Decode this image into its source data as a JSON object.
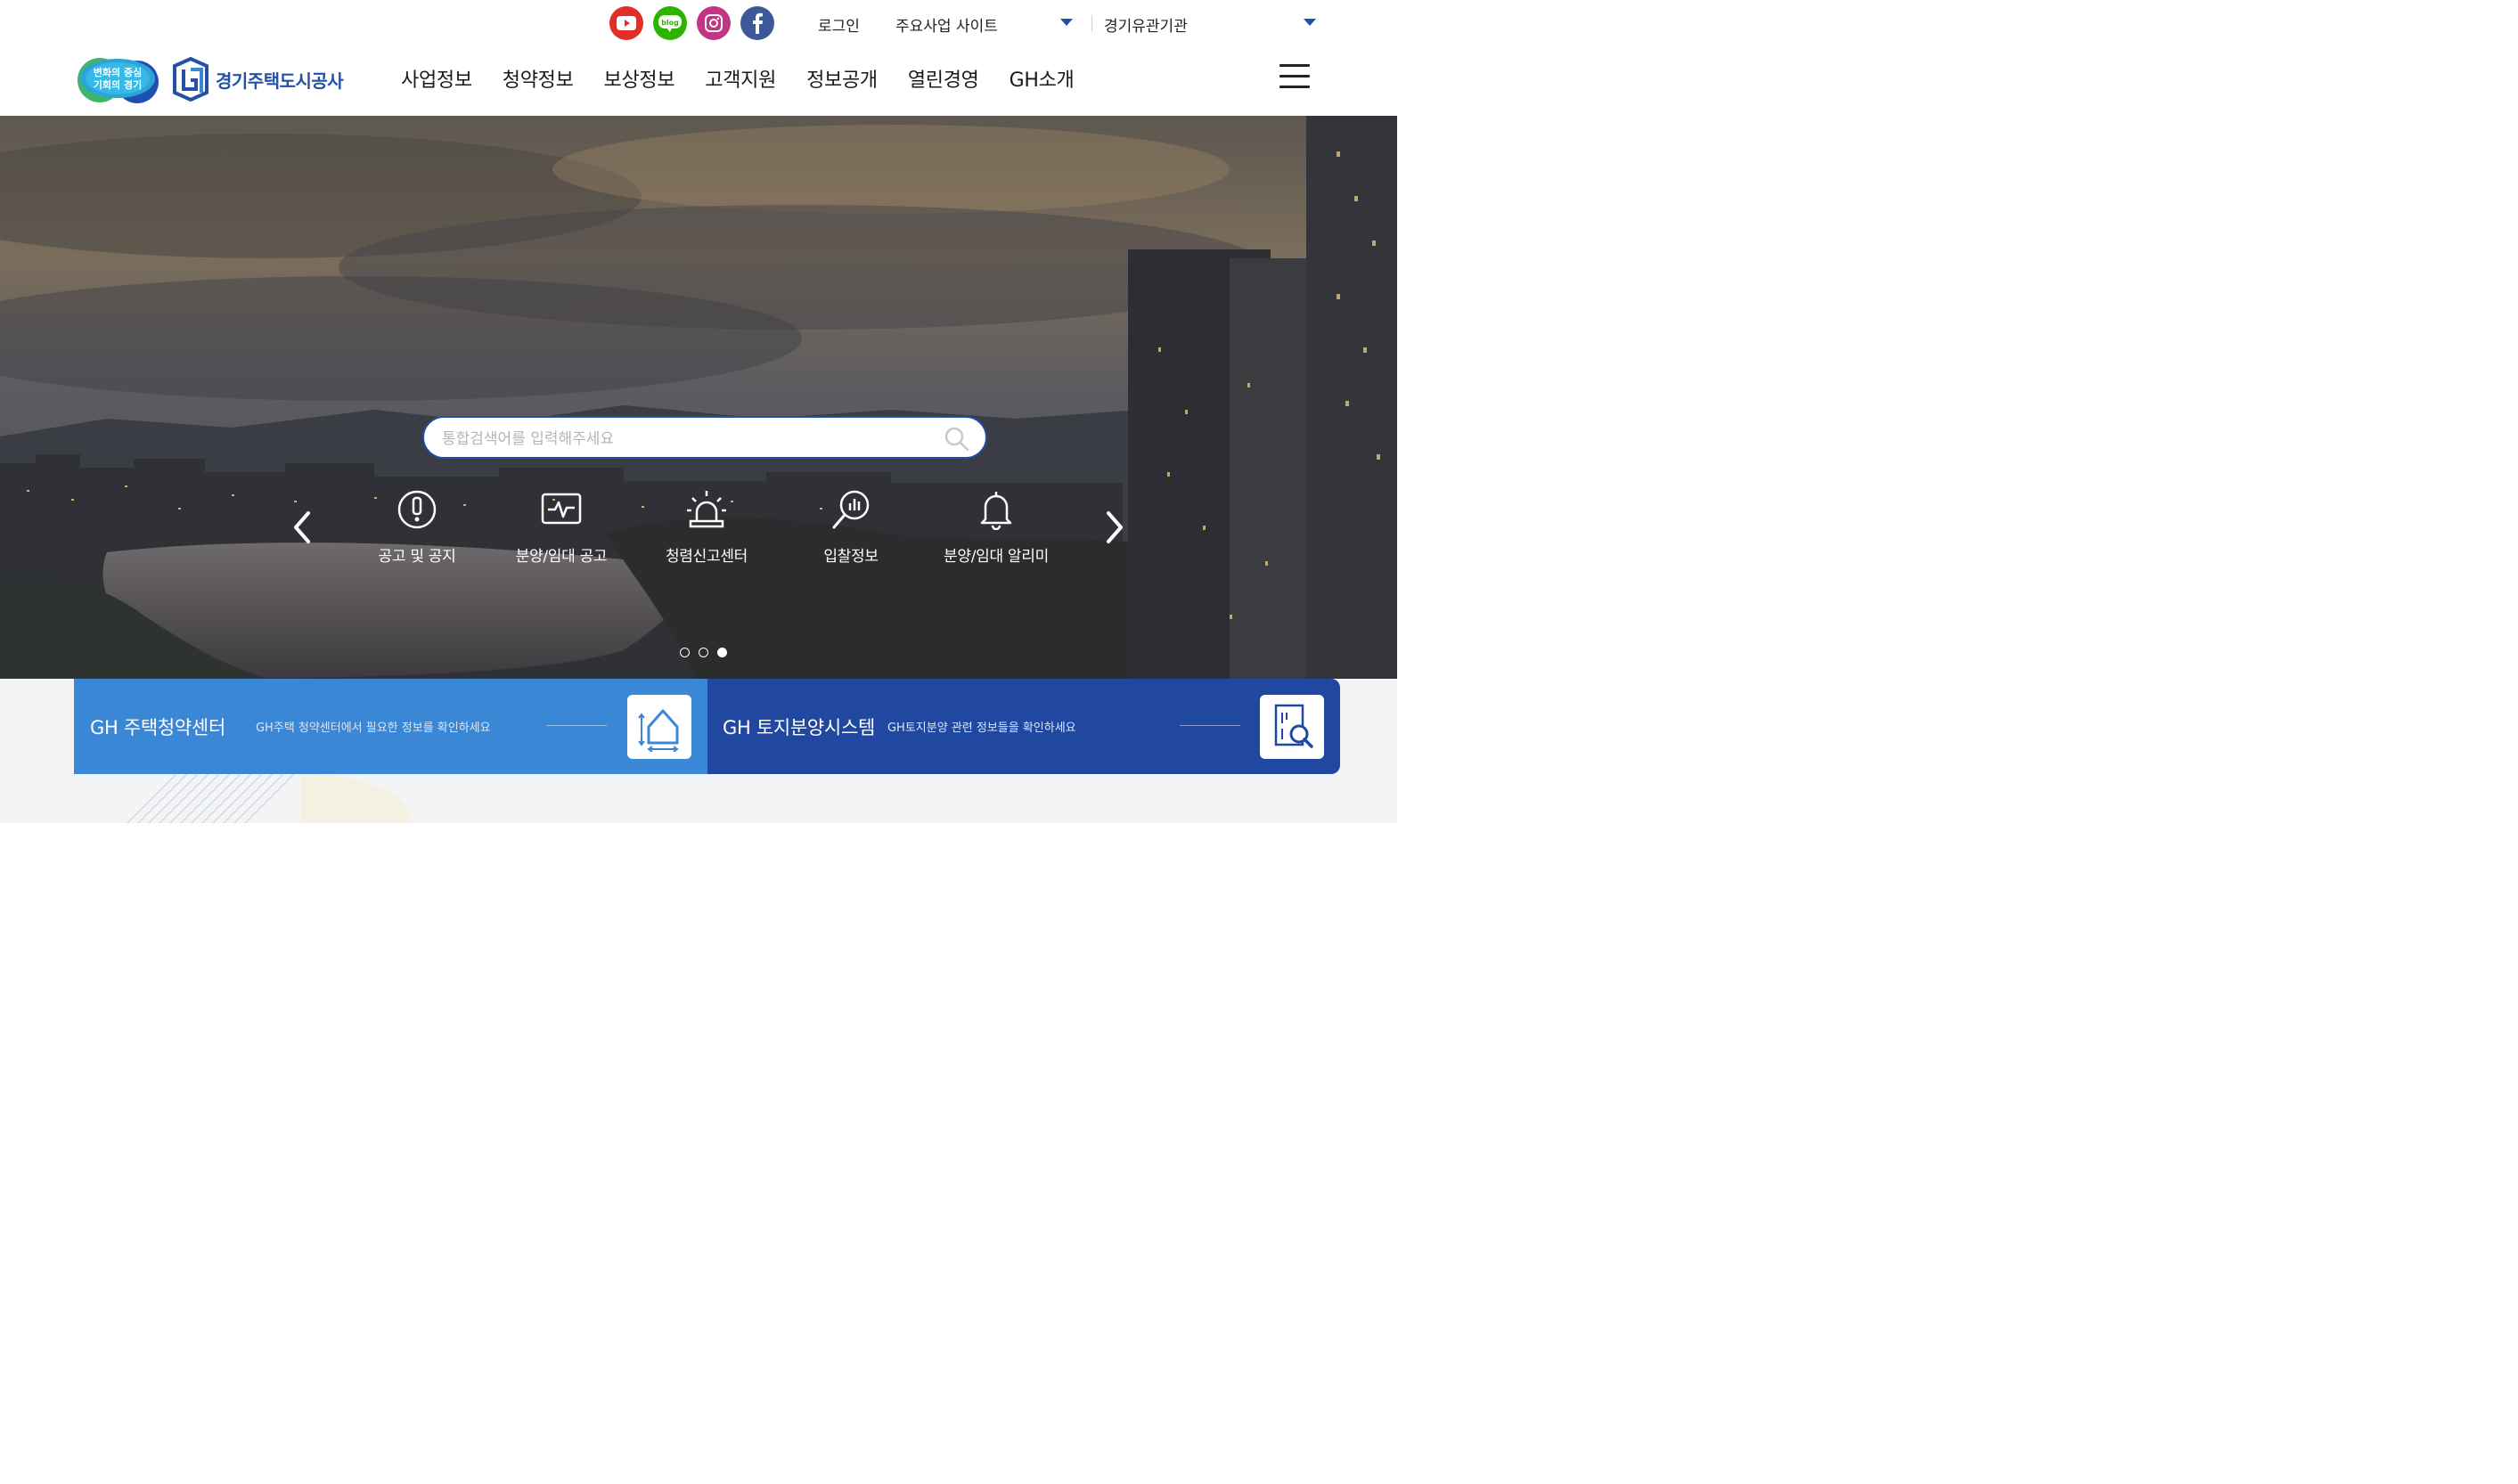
{
  "util": {
    "sns": [
      {
        "name": "YouTube",
        "icon": "youtube-icon",
        "color": "#e52d27"
      },
      {
        "name": "blog",
        "icon": "blog-icon",
        "color": "#2db400"
      },
      {
        "name": "Instagram",
        "icon": "instagram-icon",
        "color": "#c13584"
      },
      {
        "name": "Facebook",
        "icon": "facebook-icon",
        "color": "#3b5998"
      }
    ],
    "blog_text": "blog",
    "login": "로그인",
    "major_sites": "주요사업 사이트",
    "affiliates": "경기유관기관"
  },
  "header": {
    "badge_line1": "변화의 중심",
    "badge_line2": "기회의 경기",
    "logo_text": "경기주택도시공사",
    "nav": [
      "사업정보",
      "청약정보",
      "보상정보",
      "고객지원",
      "정보공개",
      "열린경영",
      "GH소개"
    ]
  },
  "hero": {
    "search_placeholder": "통합검색어를 입력해주세요",
    "quick_links": [
      {
        "label": "공고 및 공지",
        "icon": "exclamation-icon"
      },
      {
        "label": "분양/임대 공고",
        "icon": "pulse-monitor-icon"
      },
      {
        "label": "청렴신고센터",
        "icon": "siren-icon"
      },
      {
        "label": "입찰정보",
        "icon": "chart-search-icon"
      },
      {
        "label": "분양/임대 알리미",
        "icon": "bell-icon"
      }
    ],
    "slide_count": 3,
    "active_slide": 3
  },
  "banners": [
    {
      "title": "GH 주택청약센터",
      "desc": "GH주택 청약센터에서 필요한 정보를 확인하세요",
      "icon": "house-icon",
      "color": "#3a87d6"
    },
    {
      "title": "GH 토지분양시스템",
      "desc": "GH토지분양 관련 정보들을 확인하세요",
      "icon": "document-search-icon",
      "color": "#2148a0"
    }
  ],
  "colors": {
    "accent": "#1f4ea3",
    "brand_blue": "#2451a6"
  }
}
